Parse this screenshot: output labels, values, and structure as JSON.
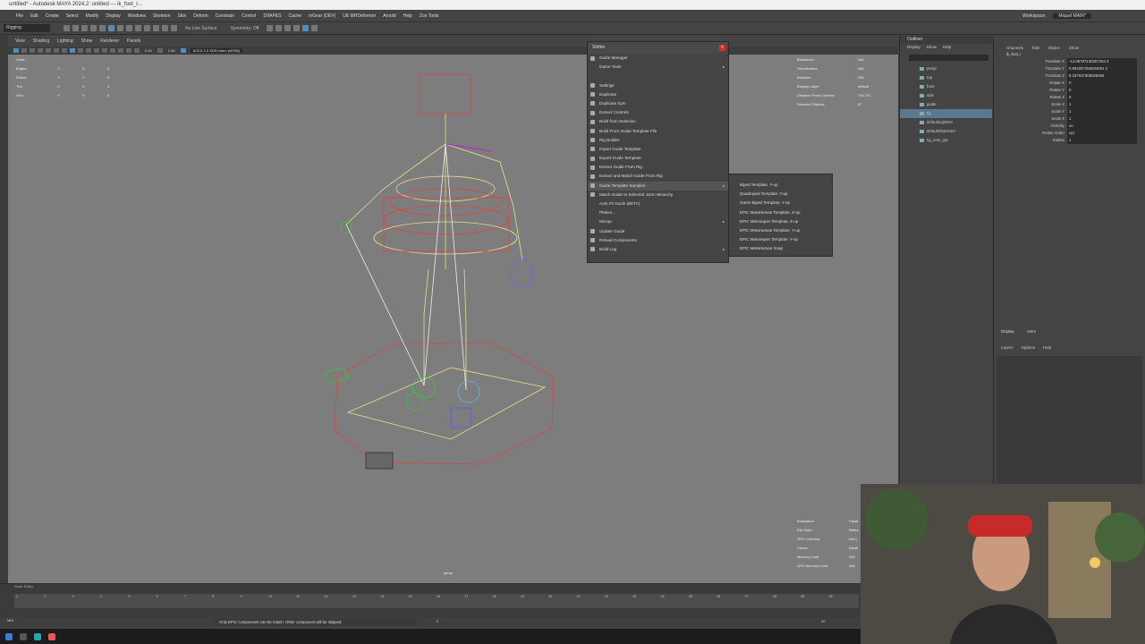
{
  "app": {
    "title": "untitled* - Autodesk MAYA 2024.2: untitled   ---   ik_foot_r..."
  },
  "menubar": [
    "File",
    "Edit",
    "Create",
    "Select",
    "Modify",
    "Display",
    "Windows",
    "Skeleton",
    "Skin",
    "Deform",
    "Constrain",
    "Control",
    "SHAPES",
    "Cache",
    "mGear (DEV)",
    "UE MHDeformer",
    "Arnold",
    "Help",
    "Zoo Tools"
  ],
  "workspace": {
    "label": "Workspace:",
    "value": "Miquel MAIN*"
  },
  "shelf": {
    "mode": "Rigging",
    "live_surface": "No Live Surface",
    "symmetry": "Symmetry: Off"
  },
  "viewport_menu": [
    "View",
    "Shading",
    "Lighting",
    "Show",
    "Renderer",
    "Panels"
  ],
  "viewport_toolbar": {
    "a": "0.00",
    "b": "1.00",
    "colorspace": "ACES 1.0 SDR-video (sRGB)"
  },
  "hud_left": {
    "rows": [
      {
        "label": "Verts:",
        "a": "",
        "b": "",
        "c": ""
      },
      {
        "label": "Edges:",
        "a": "0",
        "b": "0",
        "c": "0"
      },
      {
        "label": "Faces:",
        "a": "0",
        "b": "0",
        "c": "0"
      },
      {
        "label": "Tris:",
        "a": "0",
        "b": "0",
        "c": "0"
      },
      {
        "label": "UVs:",
        "a": "0",
        "b": "0",
        "c": "0"
      }
    ]
  },
  "hud_right": {
    "rows": [
      {
        "label": "Backfaces:",
        "value": "N/A"
      },
      {
        "label": "Smoothness:",
        "value": "N/A"
      },
      {
        "label": "Instance:",
        "value": "N/A"
      },
      {
        "label": "Display Layer:",
        "value": "default"
      },
      {
        "label": "Distance From Camera:",
        "value": "724.731"
      },
      {
        "label": "Selected Objects:",
        "value": "87"
      }
    ]
  },
  "hud_bottom": {
    "rows": [
      {
        "label": "Evaluation:",
        "value": "Parall"
      },
      {
        "label": "EM State:",
        "value": "Rebui"
      },
      {
        "label": "GPU Override:",
        "value": "Not L"
      },
      {
        "label": "Cache:",
        "value": "Disab"
      },
      {
        "label": "Memory Limit:",
        "value": "N/A"
      },
      {
        "label": "GPU Memory Limit:",
        "value": "N/A"
      }
    ]
  },
  "camera_label": "persp",
  "shifter": {
    "title": "Shifter",
    "close": "×",
    "items": [
      {
        "label": "Guide Manager",
        "icon": "guide-icon",
        "arrow": ""
      },
      {
        "label": "Game Tools",
        "icon": "",
        "arrow": "▸"
      },
      {
        "label": "",
        "icon": "",
        "arrow": ""
      },
      {
        "label": "Settings",
        "icon": "settings-icon",
        "arrow": ""
      },
      {
        "label": "Duplicate",
        "icon": "duplicate-icon",
        "arrow": ""
      },
      {
        "label": "Duplicate Sym",
        "icon": "duplicate-sym-icon",
        "arrow": ""
      },
      {
        "label": "Extract Controls",
        "icon": "extract-icon",
        "arrow": ""
      },
      {
        "label": "Build from Selection",
        "icon": "build-icon",
        "arrow": ""
      },
      {
        "label": "Build From Guide Template File",
        "icon": "build-file-icon",
        "arrow": ""
      },
      {
        "label": "Rig Builder",
        "icon": "rig-builder-icon",
        "arrow": ""
      },
      {
        "label": "Import Guide Template",
        "icon": "import-icon",
        "arrow": ""
      },
      {
        "label": "Export Guide Template",
        "icon": "export-icon",
        "arrow": ""
      },
      {
        "label": "Extract Guide From Rig",
        "icon": "extract-guide-icon",
        "arrow": ""
      },
      {
        "label": "Extract and Match Guide From Rig",
        "icon": "extract-match-icon",
        "arrow": ""
      },
      {
        "label": "Guide Template Samples",
        "icon": "samples-icon",
        "arrow": "▸"
      },
      {
        "label": "Match Guide to Selected Joint Hierarchy",
        "icon": "match-icon",
        "arrow": ""
      },
      {
        "label": "Auto Fit Guide (BETA)",
        "icon": "",
        "arrow": ""
      },
      {
        "label": "Plebes...",
        "icon": "",
        "arrow": ""
      },
      {
        "label": "Mocap",
        "icon": "",
        "arrow": "▸"
      },
      {
        "label": "Update Guide",
        "icon": "update-icon",
        "arrow": ""
      },
      {
        "label": "Reload Components",
        "icon": "reload-icon",
        "arrow": ""
      },
      {
        "label": "Build Log",
        "icon": "log-icon",
        "arrow": "▸"
      }
    ]
  },
  "submenu": [
    "Biped Template, Y-up",
    "Quadruped Template, Y-up",
    "Game Biped Template, Y-up",
    "EPIC MetaHuman Template, Z-up",
    "EPIC Mannequin Template, Z-up",
    "EPIC MetaHuman Template, Y-up",
    "EPIC Mannequin Template, Y-up",
    "EPIC MetaHuman Snap"
  ],
  "outliner": {
    "title": "Outliner",
    "menu": [
      "Display",
      "Show",
      "Help"
    ],
    "items": [
      {
        "label": "persp",
        "selected": false
      },
      {
        "label": "top",
        "selected": false
      },
      {
        "label": "front",
        "selected": false
      },
      {
        "label": "side",
        "selected": false
      },
      {
        "label": "guide",
        "selected": false
      },
      {
        "label": "rig",
        "selected": true
      },
      {
        "label": "defaultLightSet",
        "selected": false
      },
      {
        "label": "defaultObjectSet",
        "selected": false
      },
      {
        "label": "rig_sets_grp",
        "selected": false
      }
    ]
  },
  "channel_box": {
    "menu": [
      "Channels",
      "Edit",
      "Object",
      "Show"
    ],
    "object": "ik_foot_r",
    "channels": [
      {
        "name": "Translate X",
        "value": "-14.08787130267254 3"
      },
      {
        "name": "Translate Y",
        "value": "0.994257356034061 2"
      },
      {
        "name": "Translate Z",
        "value": "8.237637308028492"
      },
      {
        "name": "Rotate X",
        "value": "0"
      },
      {
        "name": "Rotate Y",
        "value": "0"
      },
      {
        "name": "Rotate Z",
        "value": "0"
      },
      {
        "name": "Scale X",
        "value": "1"
      },
      {
        "name": "Scale Y",
        "value": "1"
      },
      {
        "name": "Scale Z",
        "value": "1"
      },
      {
        "name": "Visibility",
        "value": "on"
      },
      {
        "name": "Rotate Order",
        "value": "xyz"
      },
      {
        "name": "Radius",
        "value": "1"
      }
    ]
  },
  "layers": {
    "tabs": [
      "Display",
      "Anim"
    ],
    "menu": [
      "Layers",
      "Options",
      "Help"
    ]
  },
  "timeline": {
    "label": "Node Editor",
    "ticks": [
      "1",
      "2",
      "3",
      "4",
      "5",
      "6",
      "7",
      "8",
      "9",
      "10",
      "11",
      "12",
      "13",
      "14",
      "15",
      "16",
      "17",
      "18",
      "19",
      "20",
      "21",
      "22",
      "23",
      "24",
      "25",
      "26",
      "27",
      "28",
      "29",
      "30"
    ],
    "start": "0",
    "end": "30"
  },
  "status": {
    "mel": "MEL",
    "message": "Only EPIC components can be match. Other component will be skipped",
    "range_start": "0",
    "range_end": "30"
  },
  "colors": {
    "selection": "#5b7891",
    "close": "#d53030",
    "accent": "#4c8fc0"
  }
}
